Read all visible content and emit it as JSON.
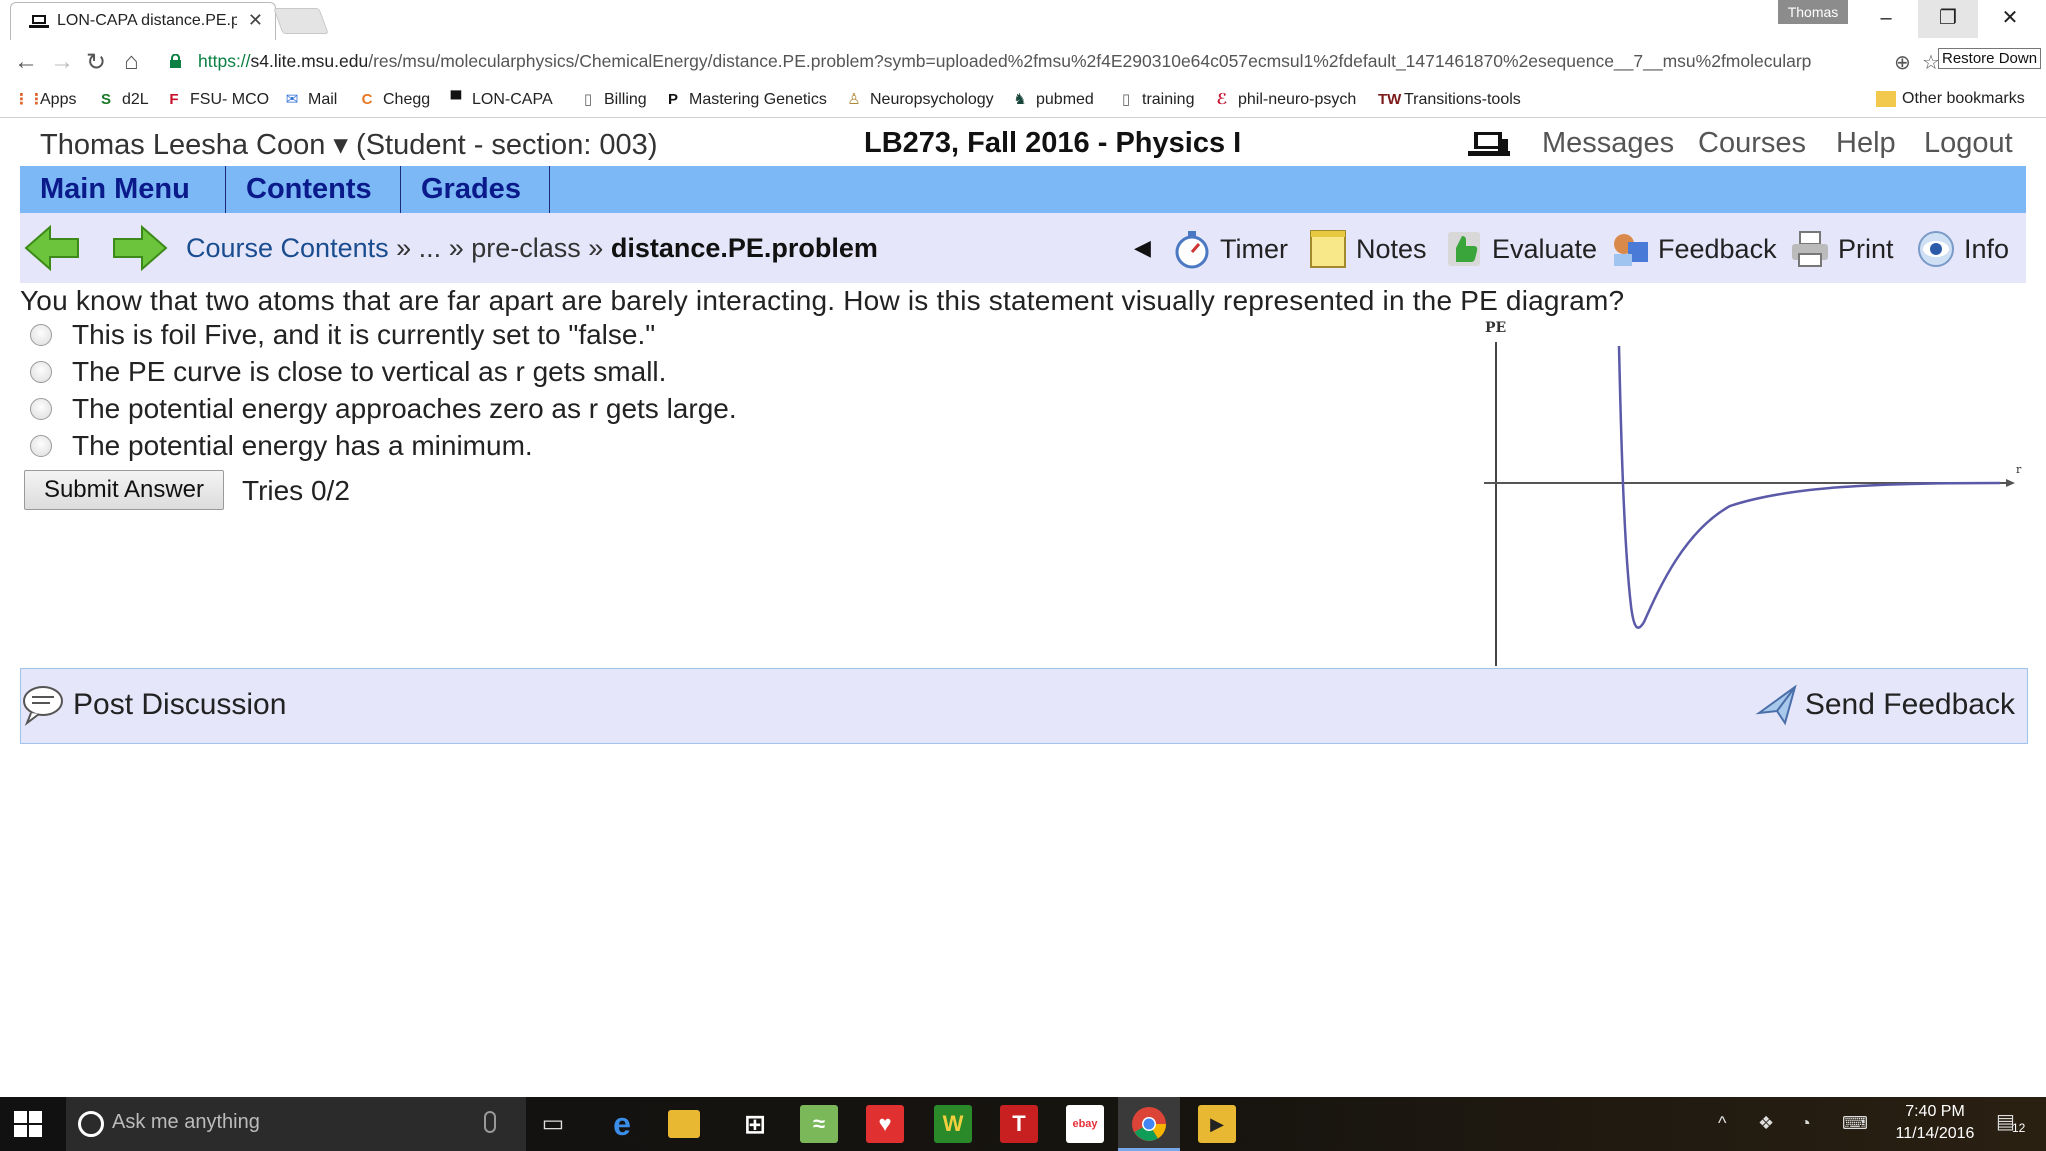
{
  "browser": {
    "tab_title": "LON-CAPA distance.PE.pr",
    "window_user": "Thomas",
    "url_scheme": "https://",
    "url_host": "s4.lite.msu.edu",
    "url_path": "/res/msu/molecularphysics/ChemicalEnergy/distance.PE.problem?symb=uploaded%2fmsu%2f4E290310e64c057ecmsul1%2fdefault_1471461870%2esequence__7__msu%2fmolecularp",
    "restore_tooltip": "Restore Down",
    "bookmarks": [
      {
        "label": "Apps",
        "icon": "apps-grid-icon",
        "color": "#e0612a"
      },
      {
        "label": "d2L",
        "icon": "d2l-icon",
        "color": "#1a7a2a"
      },
      {
        "label": "FSU- MCO",
        "icon": "fsu-icon",
        "color": "#c8102e"
      },
      {
        "label": "Mail",
        "icon": "mail-icon",
        "color": "#2a6bd6"
      },
      {
        "label": "Chegg",
        "icon": "chegg-icon",
        "color": "#e87722"
      },
      {
        "label": "LON-CAPA",
        "icon": "loncapa-icon",
        "color": "#111111"
      },
      {
        "label": "Billing",
        "icon": "page-icon",
        "color": "#666666"
      },
      {
        "label": "Mastering Genetics",
        "icon": "mastering-icon",
        "color": "#111111"
      },
      {
        "label": "Neuropsychology",
        "icon": "neuro-icon",
        "color": "#b08a3a"
      },
      {
        "label": "pubmed",
        "icon": "spartan-icon",
        "color": "#18453b"
      },
      {
        "label": "training",
        "icon": "page-icon",
        "color": "#666666"
      },
      {
        "label": "phil-neuro-psych",
        "icon": "phil-icon",
        "color": "#c8102e"
      },
      {
        "label": "Transitions-tools",
        "icon": "twt-icon",
        "color": "#7a1a1a"
      }
    ],
    "other_bookmarks": "Other bookmarks"
  },
  "header": {
    "user": "Thomas Leesha Coon ▾",
    "role": "(Student  - section: 003)",
    "course": "LB273, Fall 2016 - Physics I",
    "links": [
      "Messages",
      "Courses",
      "Help",
      "Logout"
    ]
  },
  "main_nav": [
    "Main Menu",
    "Contents",
    "Grades"
  ],
  "sub_nav": {
    "crumb_root": "Course Contents",
    "crumb_sep": "»",
    "crumb_ellipsis": "...",
    "crumb_folder": "pre-class",
    "crumb_current": "distance.PE.problem",
    "collapse": "◀",
    "tools": [
      "Timer",
      "Notes",
      "Evaluate",
      "Feedback",
      "Print",
      "Info"
    ]
  },
  "problem": {
    "question": "You know that two atoms that are far apart are barely interacting. How is this statement visually represented in the PE diagram?",
    "options": [
      "This is foil Five, and it is currently set to \"false.\"",
      "The PE curve is close to vertical as r gets small.",
      "The potential energy approaches zero as r gets large.",
      "The potential energy has a minimum."
    ],
    "submit_label": "Submit Answer",
    "tries": "Tries 0/2",
    "diagram_ylabel": "PE",
    "diagram_xlabel": "r"
  },
  "footer": {
    "post_discussion": "Post Discussion",
    "send_feedback": "Send Feedback"
  },
  "taskbar": {
    "search_placeholder": "Ask me anything",
    "time": "7:40 PM",
    "date": "11/14/2016",
    "notifications": "12"
  },
  "colors": {
    "nav_blue": "#7cb8f5",
    "nav_text": "#0a1a8a",
    "subnav_bg": "#e6e6fa",
    "curve": "#5a5aa8"
  }
}
